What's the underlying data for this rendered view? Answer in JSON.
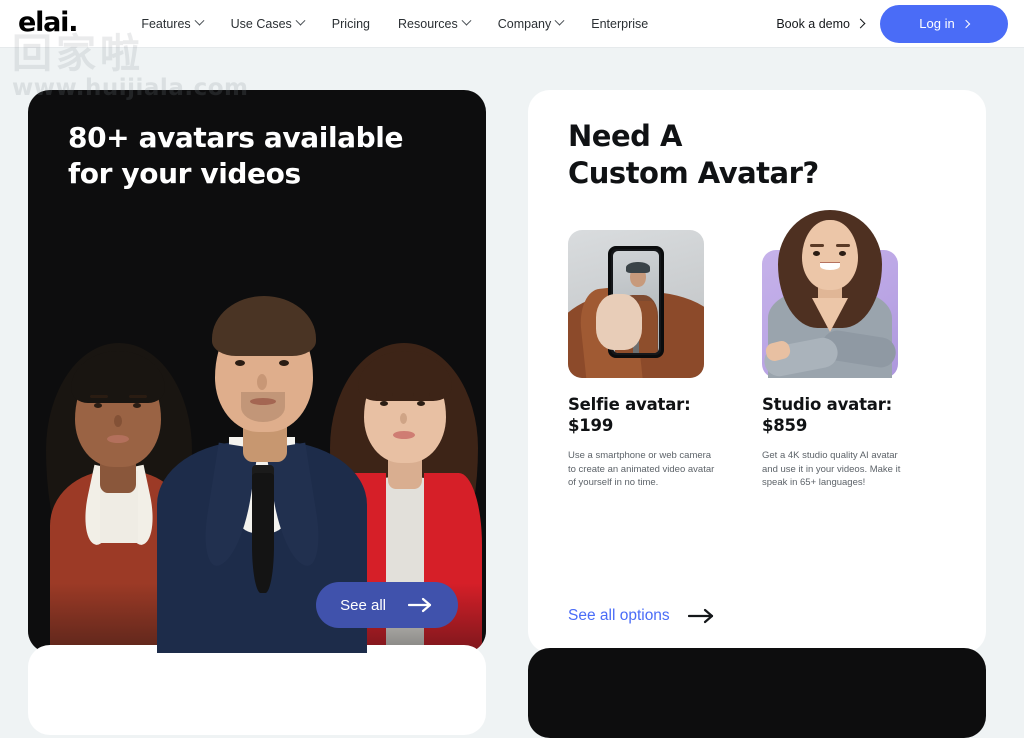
{
  "header": {
    "logo": "elai.",
    "nav": [
      {
        "label": "Features",
        "has_dropdown": true
      },
      {
        "label": "Use Cases",
        "has_dropdown": true
      },
      {
        "label": "Pricing",
        "has_dropdown": false
      },
      {
        "label": "Resources",
        "has_dropdown": true
      },
      {
        "label": "Company",
        "has_dropdown": true
      },
      {
        "label": "Enterprise",
        "has_dropdown": false
      }
    ],
    "book_demo": "Book a demo",
    "login": "Log in",
    "accent_color": "#4a6cf7"
  },
  "watermark": {
    "cn_text": "回家啦",
    "url_text": "www.huijiala.com"
  },
  "hero": {
    "title_line1": "80+ avatars available",
    "title_line2": "for your videos",
    "cta_label": "See all",
    "cta_icon": "arrow-right-icon",
    "background_color": "#0d0d0e",
    "cta_color": "#4052ac"
  },
  "custom": {
    "title_line1": "Need A",
    "title_line2": "Custom Avatar?",
    "options": [
      {
        "image_name": "selfie-avatar-photo",
        "title_line1": "Selfie avatar:",
        "price": "$199",
        "desc": "Use a smartphone or web camera to create an animated video avatar of yourself in no time."
      },
      {
        "image_name": "studio-avatar-photo",
        "title_line1": "Studio avatar:",
        "price": "$859",
        "desc": "Get a 4K studio quality AI avatar and use it in your videos. Make it speak in 65+ languages!"
      }
    ],
    "link_label": "See all options",
    "link_icon": "arrow-right-icon",
    "link_color": "#4a6cf7"
  },
  "page": {
    "background_color": "#eff3f4"
  }
}
